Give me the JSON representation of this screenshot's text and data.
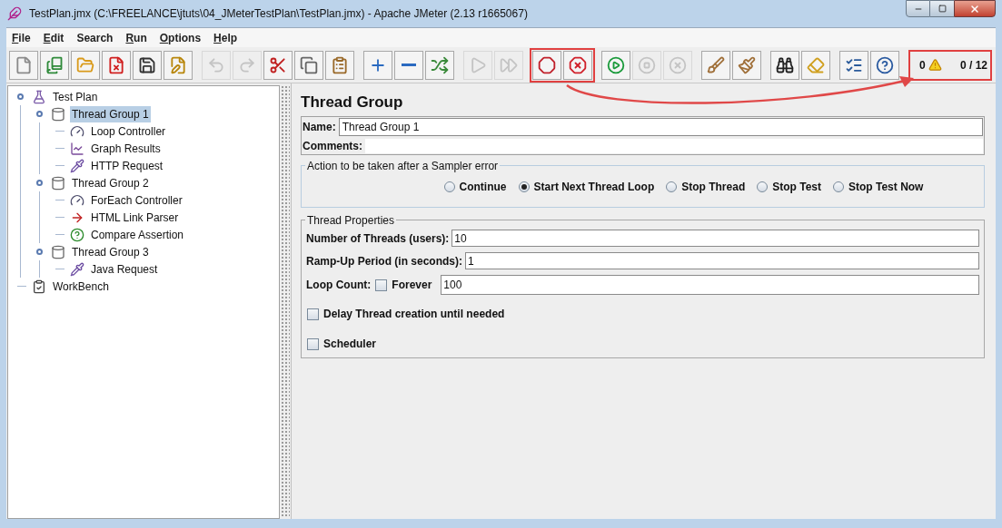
{
  "window": {
    "title": "TestPlan.jmx (C:\\FREELANCE\\jtuts\\04_JMeterTestPlan\\TestPlan.jmx) - Apache JMeter (2.13 r1665067)"
  },
  "menu": [
    {
      "label": "File",
      "mnemonic": true
    },
    {
      "label": "Edit",
      "mnemonic": true
    },
    {
      "label": "Search",
      "mnemonic": false
    },
    {
      "label": "Run",
      "mnemonic": true
    },
    {
      "label": "Options",
      "mnemonic": true
    },
    {
      "label": "Help",
      "mnemonic": true
    }
  ],
  "toolbar": [
    {
      "highlighted": false,
      "buttons": [
        {
          "kind": "new",
          "disabled": false
        },
        {
          "kind": "templates",
          "disabled": false
        },
        {
          "kind": "open",
          "disabled": false
        },
        {
          "kind": "close",
          "disabled": false
        },
        {
          "kind": "save",
          "disabled": false
        },
        {
          "kind": "save-screen",
          "disabled": false
        }
      ]
    },
    {
      "highlighted": false,
      "buttons": [
        {
          "kind": "undo",
          "disabled": true
        },
        {
          "kind": "redo",
          "disabled": true
        },
        {
          "kind": "cut",
          "disabled": false
        },
        {
          "kind": "copy",
          "disabled": false
        },
        {
          "kind": "paste",
          "disabled": false
        }
      ]
    },
    {
      "highlighted": false,
      "buttons": [
        {
          "kind": "add",
          "disabled": false
        },
        {
          "kind": "remove",
          "disabled": false
        },
        {
          "kind": "toggle",
          "disabled": false
        }
      ]
    },
    {
      "highlighted": false,
      "buttons": [
        {
          "kind": "start",
          "disabled": true
        },
        {
          "kind": "start-no-pause",
          "disabled": true
        }
      ]
    },
    {
      "highlighted": true,
      "buttons": [
        {
          "kind": "stop",
          "disabled": false
        },
        {
          "kind": "shutdown",
          "disabled": false
        }
      ]
    },
    {
      "highlighted": false,
      "buttons": [
        {
          "kind": "remote-start",
          "disabled": false
        },
        {
          "kind": "remote-stop",
          "disabled": true
        },
        {
          "kind": "remote-shutdown",
          "disabled": true
        }
      ]
    },
    {
      "highlighted": false,
      "buttons": [
        {
          "kind": "clear",
          "disabled": false
        },
        {
          "kind": "clear-all",
          "disabled": false
        }
      ]
    },
    {
      "highlighted": false,
      "buttons": [
        {
          "kind": "search",
          "disabled": false
        },
        {
          "kind": "reset-search",
          "disabled": false
        }
      ]
    },
    {
      "highlighted": false,
      "buttons": [
        {
          "kind": "function-helper",
          "disabled": false
        },
        {
          "kind": "help",
          "disabled": false
        }
      ]
    }
  ],
  "status": {
    "errors": "0",
    "threads": "0 / 12",
    "highlighted": true
  },
  "tree": [
    {
      "label": "Test Plan",
      "kind": "test-plan",
      "selected": false,
      "expanded": true,
      "children": [
        {
          "label": "Thread Group 1",
          "kind": "thread-group",
          "selected": true,
          "expanded": true,
          "children": [
            {
              "label": "Loop Controller",
              "kind": "controller",
              "selected": false
            },
            {
              "label": "Graph Results",
              "kind": "graph",
              "selected": false
            },
            {
              "label": "HTTP Request",
              "kind": "sampler",
              "selected": false
            }
          ]
        },
        {
          "label": "Thread Group 2",
          "kind": "thread-group",
          "selected": false,
          "expanded": true,
          "children": [
            {
              "label": "ForEach Controller",
              "kind": "controller",
              "selected": false
            },
            {
              "label": "HTML Link Parser",
              "kind": "link-parser",
              "selected": false
            },
            {
              "label": "Compare Assertion",
              "kind": "assertion",
              "selected": false
            }
          ]
        },
        {
          "label": "Thread Group 3",
          "kind": "thread-group",
          "selected": false,
          "expanded": true,
          "children": [
            {
              "label": "Java Request",
              "kind": "sampler",
              "selected": false
            }
          ]
        }
      ]
    },
    {
      "label": "WorkBench",
      "kind": "workbench",
      "selected": false
    }
  ],
  "panel": {
    "title": "Thread Group",
    "name_label": "Name:",
    "name_value": "Thread Group 1",
    "comments_label": "Comments:",
    "error_action": {
      "legend": "Action to be taken after a Sampler error",
      "options": [
        {
          "label": "Continue",
          "selected": false
        },
        {
          "label": "Start Next Thread Loop",
          "selected": true
        },
        {
          "label": "Stop Thread",
          "selected": false
        },
        {
          "label": "Stop Test",
          "selected": false
        },
        {
          "label": "Stop Test Now",
          "selected": false
        }
      ]
    },
    "thread_properties": {
      "legend": "Thread Properties",
      "threads_label": "Number of Threads (users):",
      "threads_value": "10",
      "rampup_label": "Ramp-Up Period (in seconds):",
      "rampup_value": "1",
      "loop_label": "Loop Count:",
      "forever": {
        "label": "Forever",
        "checked": false
      },
      "loop_value": "100",
      "delay": {
        "label": "Delay Thread creation until needed",
        "checked": false
      },
      "scheduler": {
        "label": "Scheduler",
        "checked": false
      }
    }
  }
}
